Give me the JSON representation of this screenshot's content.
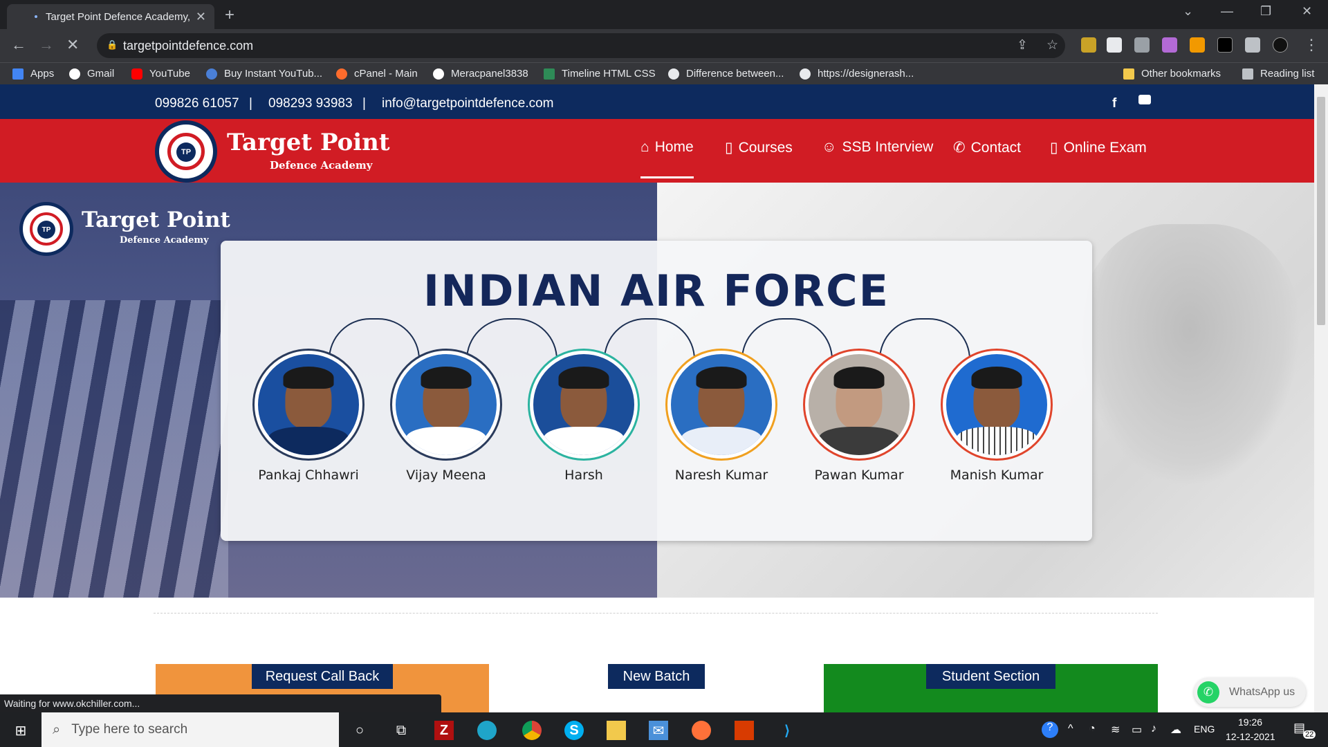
{
  "browser": {
    "tab_title": "Target Point Defence Academy, J",
    "url": "targetpointdefence.com",
    "status_text": "Waiting for www.okchiller.com...",
    "bookmarks": [
      "Apps",
      "Gmail",
      "YouTube",
      "Buy Instant YouTub...",
      "cPanel - Main",
      "Meracpanel3838",
      "Timeline HTML CSS",
      "Difference between...",
      "https://designerash...",
      "Other bookmarks",
      "Reading list"
    ]
  },
  "topbar": {
    "phone1": "099826 61057",
    "sep": "|",
    "phone2": "098293 93983",
    "email": "info@targetpointdefence.com"
  },
  "brand": {
    "name": "Target Point",
    "sub": "Defence Academy",
    "initials": "TP"
  },
  "nav": {
    "home": "Home",
    "courses": "Courses",
    "ssb": "SSB Interview",
    "contact": "Contact",
    "exam": "Online Exam"
  },
  "hero": {
    "title": "INDIAN AIR FORCE",
    "people": [
      "Pankaj Chhawri",
      "Vijay Meena",
      "Harsh",
      "Naresh Kumar",
      "Pawan Kumar",
      "Manish Kumar"
    ]
  },
  "sections": {
    "callback": "Request Call Back",
    "batch": "New Batch",
    "student": "Student Section"
  },
  "whatsapp": "WhatsApp us",
  "taskbar": {
    "search_placeholder": "Type here to search",
    "lang": "ENG",
    "time": "19:26",
    "date": "12-12-2021",
    "notif_count": "22"
  },
  "colors": {
    "topbar": "#0d2a5e",
    "navbar": "#d11c24",
    "callback_box": "#f0943d",
    "student_box": "#138a1e"
  },
  "icons": [
    "facebook-icon",
    "youtube-icon",
    "home-icon",
    "book-icon",
    "user-icon",
    "phone-icon",
    "mobile-icon",
    "whatsapp-icon"
  ]
}
